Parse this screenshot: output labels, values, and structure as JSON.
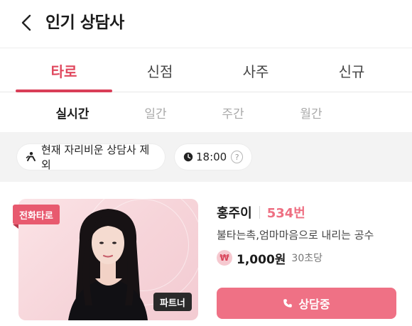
{
  "header": {
    "title": "인기 상담사"
  },
  "tabs": [
    {
      "label": "타로",
      "active": true
    },
    {
      "label": "신점",
      "active": false
    },
    {
      "label": "사주",
      "active": false
    },
    {
      "label": "신규",
      "active": false
    }
  ],
  "subtabs": [
    {
      "label": "실시간",
      "active": true
    },
    {
      "label": "일간",
      "active": false
    },
    {
      "label": "주간",
      "active": false
    },
    {
      "label": "월간",
      "active": false
    }
  ],
  "filters": {
    "exclude_label": "현재 자리비운 상담사 제외",
    "time_label": "18:00",
    "help_label": "?"
  },
  "counselor": {
    "badge_type": "전화타로",
    "badge_partner": "파트너",
    "name": "홍주이",
    "number": "534번",
    "description": "불타는촉,엄마마음으로 내리는 공수",
    "currency_symbol": "₩",
    "price": "1,000원",
    "per": "30초당",
    "button_label": "상담중"
  },
  "colors": {
    "accent": "#e0485e",
    "button": "#ef7185",
    "badge": "#e85a6f",
    "number": "#ee6f82"
  },
  "icons": {
    "back": "chevron-left-icon",
    "exclude": "away-person-icon",
    "clock": "clock-icon",
    "help": "help-circle-icon",
    "won": "won-icon",
    "phone": "phone-icon"
  }
}
